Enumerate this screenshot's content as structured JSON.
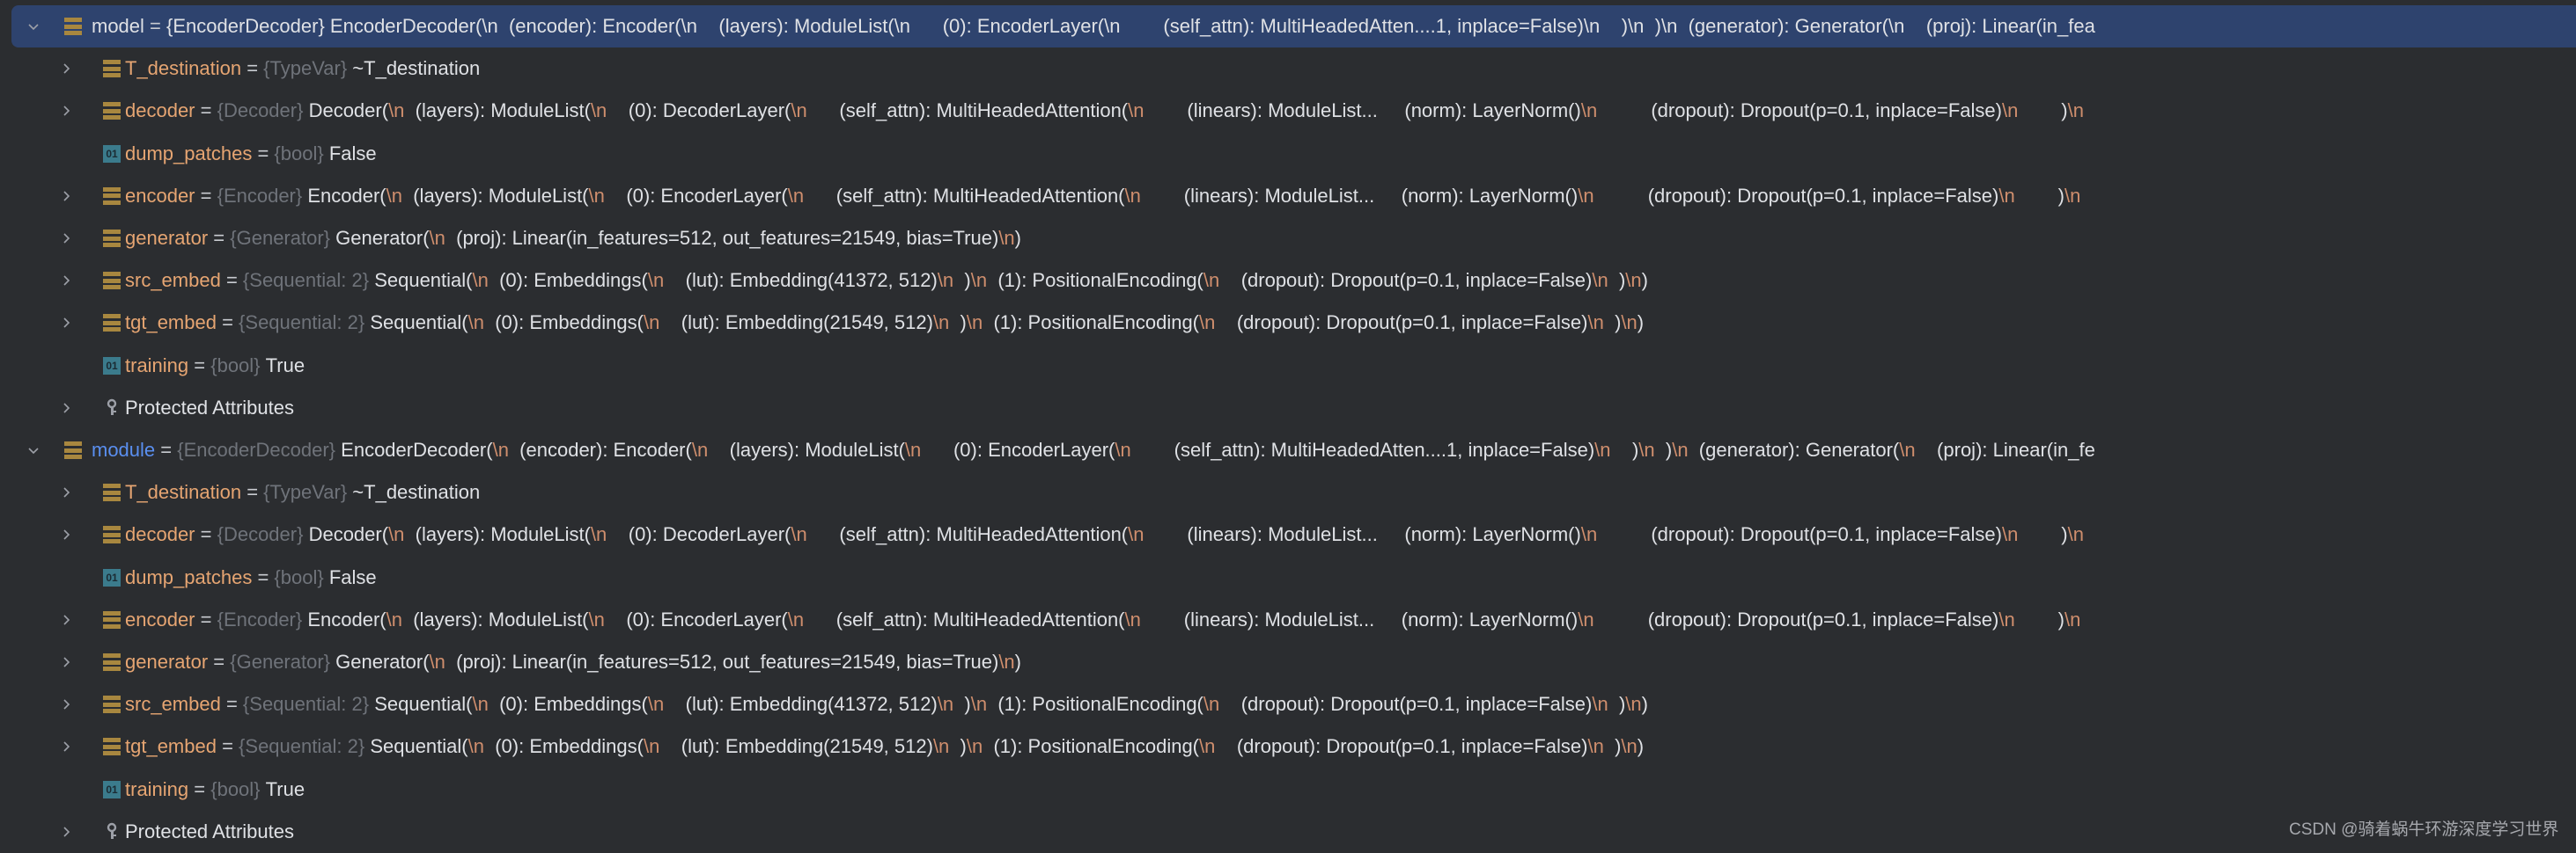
{
  "colors": {
    "background": "#2b2d30",
    "selection": "#2e436e",
    "field_name": "#e6a572",
    "module_name": "#5a8ff0",
    "type": "#6f737a",
    "value": "#dfe1e5",
    "escape": "#cf8e6d",
    "field_icon": "#a8873f",
    "bool_icon": "#3b7b8c"
  },
  "tree": [
    {
      "depth": 0,
      "expanded": true,
      "selected": true,
      "icon": "field-icon",
      "name": "model",
      "name_style": "plain",
      "type": "{EncoderDecoder}",
      "value": "EncoderDecoder(\\n  (encoder): Encoder(\\n    (layers): ModuleList(\\n      (0): EncoderLayer(\\n        (self_attn): MultiHeadedAtten....1, inplace=False)\\n    )\\n  )\\n  (generator): Generator(\\n    (proj): Linear(in_fea"
    },
    {
      "depth": 1,
      "expandable": true,
      "icon": "field-icon",
      "name": "T_destination",
      "type": "{TypeVar}",
      "value": "~T_destination"
    },
    {
      "depth": 1,
      "expandable": true,
      "icon": "field-icon",
      "name": "decoder",
      "type": "{Decoder}",
      "value": "Decoder(\\n  (layers): ModuleList(\\n    (0): DecoderLayer(\\n      (self_attn): MultiHeadedAttention(\\n        (linears): ModuleList...     (norm): LayerNorm()\\n          (dropout): Dropout(p=0.1, inplace=False)\\n        )\\n"
    },
    {
      "depth": 1,
      "expandable": false,
      "icon": "bool-icon",
      "name": "dump_patches",
      "type": "{bool}",
      "value": "False"
    },
    {
      "depth": 1,
      "expandable": true,
      "icon": "field-icon",
      "name": "encoder",
      "type": "{Encoder}",
      "value": "Encoder(\\n  (layers): ModuleList(\\n    (0): EncoderLayer(\\n      (self_attn): MultiHeadedAttention(\\n        (linears): ModuleList...     (norm): LayerNorm()\\n          (dropout): Dropout(p=0.1, inplace=False)\\n        )\\n"
    },
    {
      "depth": 1,
      "expandable": true,
      "icon": "field-icon",
      "name": "generator",
      "type": "{Generator}",
      "value": "Generator(\\n  (proj): Linear(in_features=512, out_features=21549, bias=True)\\n)"
    },
    {
      "depth": 1,
      "expandable": true,
      "icon": "field-icon",
      "name": "src_embed",
      "type": "{Sequential: 2}",
      "value": "Sequential(\\n  (0): Embeddings(\\n    (lut): Embedding(41372, 512)\\n  )\\n  (1): PositionalEncoding(\\n    (dropout): Dropout(p=0.1, inplace=False)\\n  )\\n)"
    },
    {
      "depth": 1,
      "expandable": true,
      "icon": "field-icon",
      "name": "tgt_embed",
      "type": "{Sequential: 2}",
      "value": "Sequential(\\n  (0): Embeddings(\\n    (lut): Embedding(21549, 512)\\n  )\\n  (1): PositionalEncoding(\\n    (dropout): Dropout(p=0.1, inplace=False)\\n  )\\n)"
    },
    {
      "depth": 1,
      "expandable": false,
      "icon": "bool-icon",
      "name": "training",
      "type": "{bool}",
      "value": "True"
    },
    {
      "depth": 1,
      "expandable": true,
      "icon": "key-icon",
      "name": "Protected Attributes",
      "name_style": "plain"
    },
    {
      "depth": 0,
      "expanded": true,
      "icon": "field-icon",
      "name": "module",
      "name_style": "blue",
      "type": "{EncoderDecoder}",
      "value": "EncoderDecoder(\\n  (encoder): Encoder(\\n    (layers): ModuleList(\\n      (0): EncoderLayer(\\n        (self_attn): MultiHeadedAtten....1, inplace=False)\\n    )\\n  )\\n  (generator): Generator(\\n    (proj): Linear(in_fe"
    },
    {
      "depth": 1,
      "expandable": true,
      "icon": "field-icon",
      "name": "T_destination",
      "type": "{TypeVar}",
      "value": "~T_destination"
    },
    {
      "depth": 1,
      "expandable": true,
      "icon": "field-icon",
      "name": "decoder",
      "type": "{Decoder}",
      "value": "Decoder(\\n  (layers): ModuleList(\\n    (0): DecoderLayer(\\n      (self_attn): MultiHeadedAttention(\\n        (linears): ModuleList...     (norm): LayerNorm()\\n          (dropout): Dropout(p=0.1, inplace=False)\\n        )\\n"
    },
    {
      "depth": 1,
      "expandable": false,
      "icon": "bool-icon",
      "name": "dump_patches",
      "type": "{bool}",
      "value": "False"
    },
    {
      "depth": 1,
      "expandable": true,
      "icon": "field-icon",
      "name": "encoder",
      "type": "{Encoder}",
      "value": "Encoder(\\n  (layers): ModuleList(\\n    (0): EncoderLayer(\\n      (self_attn): MultiHeadedAttention(\\n        (linears): ModuleList...     (norm): LayerNorm()\\n          (dropout): Dropout(p=0.1, inplace=False)\\n        )\\n"
    },
    {
      "depth": 1,
      "expandable": true,
      "icon": "field-icon",
      "name": "generator",
      "type": "{Generator}",
      "value": "Generator(\\n  (proj): Linear(in_features=512, out_features=21549, bias=True)\\n)"
    },
    {
      "depth": 1,
      "expandable": true,
      "icon": "field-icon",
      "name": "src_embed",
      "type": "{Sequential: 2}",
      "value": "Sequential(\\n  (0): Embeddings(\\n    (lut): Embedding(41372, 512)\\n  )\\n  (1): PositionalEncoding(\\n    (dropout): Dropout(p=0.1, inplace=False)\\n  )\\n)"
    },
    {
      "depth": 1,
      "expandable": true,
      "icon": "field-icon",
      "name": "tgt_embed",
      "type": "{Sequential: 2}",
      "value": "Sequential(\\n  (0): Embeddings(\\n    (lut): Embedding(21549, 512)\\n  )\\n  (1): PositionalEncoding(\\n    (dropout): Dropout(p=0.1, inplace=False)\\n  )\\n)"
    },
    {
      "depth": 1,
      "expandable": false,
      "icon": "bool-icon",
      "name": "training",
      "type": "{bool}",
      "value": "True"
    },
    {
      "depth": 1,
      "expandable": true,
      "icon": "key-icon",
      "name": "Protected Attributes",
      "name_style": "plain"
    }
  ],
  "bool_icon_text": "01",
  "watermark": "CSDN @骑着蜗牛环游深度学习世界"
}
